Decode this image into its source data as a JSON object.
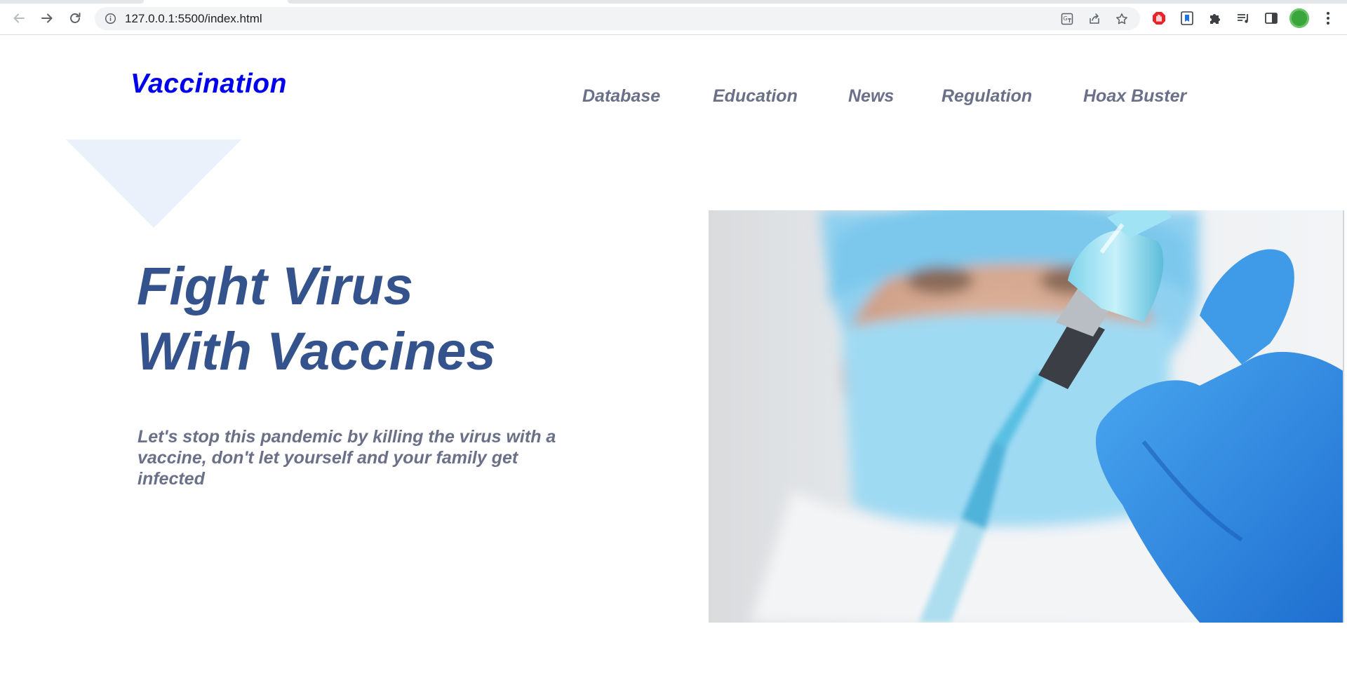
{
  "browser": {
    "url": "127.0.0.1:5500/index.html",
    "icons": {
      "back": "arrow-left-icon",
      "forward": "arrow-right-icon",
      "reload": "reload-icon",
      "site_info": "info-circle-icon",
      "translate": "translate-icon",
      "share": "share-icon",
      "bookmark": "star-icon",
      "extension_1": "red-hand-icon",
      "extension_2": "bookmark-extension-icon",
      "extensions": "puzzle-icon",
      "media": "media-queue-icon",
      "side_panel": "side-panel-icon",
      "profile": "avatar",
      "menu": "kebab-menu-icon"
    }
  },
  "page": {
    "brand": "Vaccination",
    "nav": [
      "Database",
      "Education",
      "News",
      "Regulation",
      "Hoax Buster"
    ],
    "hero": {
      "title_line1": "Fight Virus",
      "title_line2": "With Vaccines",
      "text": "Let's stop this pandemic by killing the virus with a vaccine, don't let yourself and your family get infected"
    },
    "colors": {
      "brand": "#0000ee",
      "nav": "#6b7089",
      "heading": "#34528c",
      "text": "#6b7089",
      "decor": "#eaf1fa"
    }
  }
}
